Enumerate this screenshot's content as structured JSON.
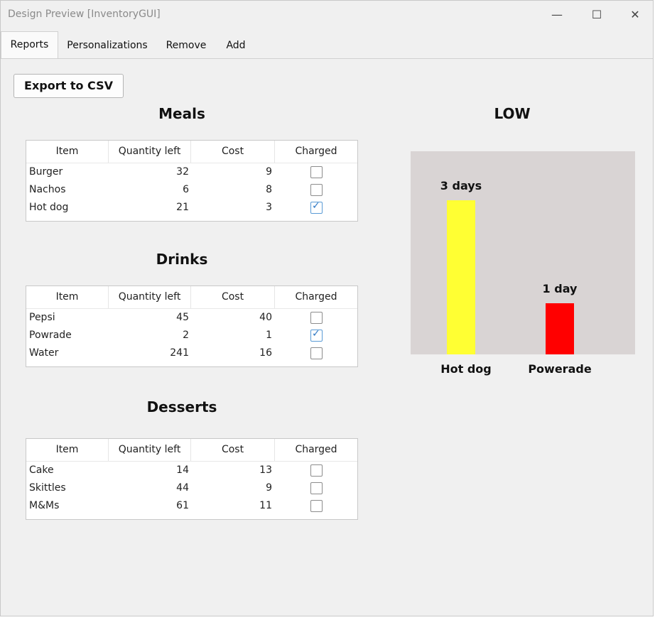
{
  "window": {
    "title": "Design Preview [InventoryGUI]",
    "minimize": "—",
    "maximize": "☐",
    "close": "✕"
  },
  "tabs": [
    {
      "label": "Reports",
      "active": true
    },
    {
      "label": "Personalizations",
      "active": false
    },
    {
      "label": "Remove",
      "active": false
    },
    {
      "label": "Add",
      "active": false
    }
  ],
  "export_button": "Export to CSV",
  "columns": [
    "Item",
    "Quantity left",
    "Cost",
    "Charged"
  ],
  "tables": [
    {
      "title": "Meals",
      "rows": [
        {
          "item": "Burger",
          "qty": "32",
          "cost": "9",
          "charged": false
        },
        {
          "item": "Nachos",
          "qty": "6",
          "cost": "8",
          "charged": false
        },
        {
          "item": "Hot dog",
          "qty": "21",
          "cost": "3",
          "charged": true
        }
      ]
    },
    {
      "title": "Drinks",
      "rows": [
        {
          "item": "Pepsi",
          "qty": "45",
          "cost": "40",
          "charged": false
        },
        {
          "item": "Powrade",
          "qty": "2",
          "cost": "1",
          "charged": true
        },
        {
          "item": "Water",
          "qty": "241",
          "cost": "16",
          "charged": false
        }
      ]
    },
    {
      "title": "Desserts",
      "rows": [
        {
          "item": "Cake",
          "qty": "14",
          "cost": "13",
          "charged": false
        },
        {
          "item": "Skittles",
          "qty": "44",
          "cost": "9",
          "charged": false
        },
        {
          "item": "M&Ms",
          "qty": "61",
          "cost": "11",
          "charged": false
        }
      ]
    }
  ],
  "chart_data": {
    "type": "bar",
    "title": "LOW",
    "categories": [
      "Hot dog",
      "Powerade"
    ],
    "values": [
      3,
      1
    ],
    "data_labels": [
      "3 days",
      "1 day"
    ],
    "colors": [
      "#ffff33",
      "#ff0000"
    ],
    "background": "#d9d4d4",
    "ylim": [
      0,
      4
    ]
  }
}
